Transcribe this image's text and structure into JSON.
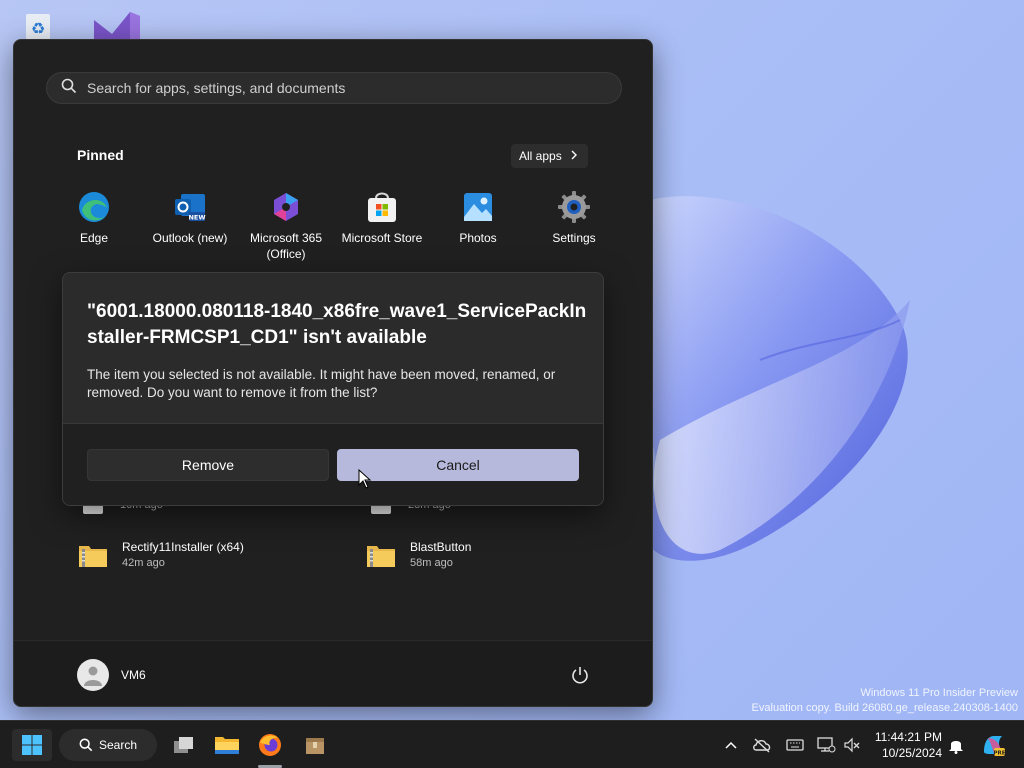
{
  "start_menu": {
    "search_placeholder": "Search for apps, settings, and documents",
    "pinned_title": "Pinned",
    "all_apps_label": "All apps",
    "pinned": [
      {
        "label": "Edge",
        "icon": "edge-icon"
      },
      {
        "label": "Outlook (new)",
        "icon": "outlook-icon"
      },
      {
        "label": "Microsoft 365\n(Office)",
        "icon": "microsoft-365-icon"
      },
      {
        "label": "Microsoft Store",
        "icon": "store-icon"
      },
      {
        "label": "Photos",
        "icon": "photos-icon"
      },
      {
        "label": "Settings",
        "icon": "settings-icon"
      }
    ],
    "recommended": [
      {
        "name": "",
        "time": "16m ago",
        "icon": "file-icon"
      },
      {
        "name": "",
        "time": "23m ago",
        "icon": "file-icon"
      },
      {
        "name": "Rectify11Installer (x64)",
        "time": "42m ago",
        "icon": "zip-folder-icon"
      },
      {
        "name": "BlastButton",
        "time": "58m ago",
        "icon": "zip-folder-icon"
      }
    ],
    "user_name": "VM6"
  },
  "dialog": {
    "title": "\"6001.18000.080118-1840_x86fre_wave1_ServicePackInstaller-FRMCSP1_CD1\" isn't available",
    "message": "The item you selected is not available. It might have been moved, renamed, or removed. Do you want to remove it from the list?",
    "remove_label": "Remove",
    "cancel_label": "Cancel"
  },
  "watermark": {
    "line1": "Windows 11 Pro Insider Preview",
    "line2": "Evaluation copy. Build 26080.ge_release.240308-1400"
  },
  "taskbar": {
    "search_label": "Search",
    "time": "11:44:21 PM",
    "date": "10/25/2024"
  },
  "colors": {
    "accent": "#b7b9dc",
    "start_bg": "#202020",
    "dialog_bg": "#2b2b2b",
    "wallpaper": "#a9bdf6"
  }
}
